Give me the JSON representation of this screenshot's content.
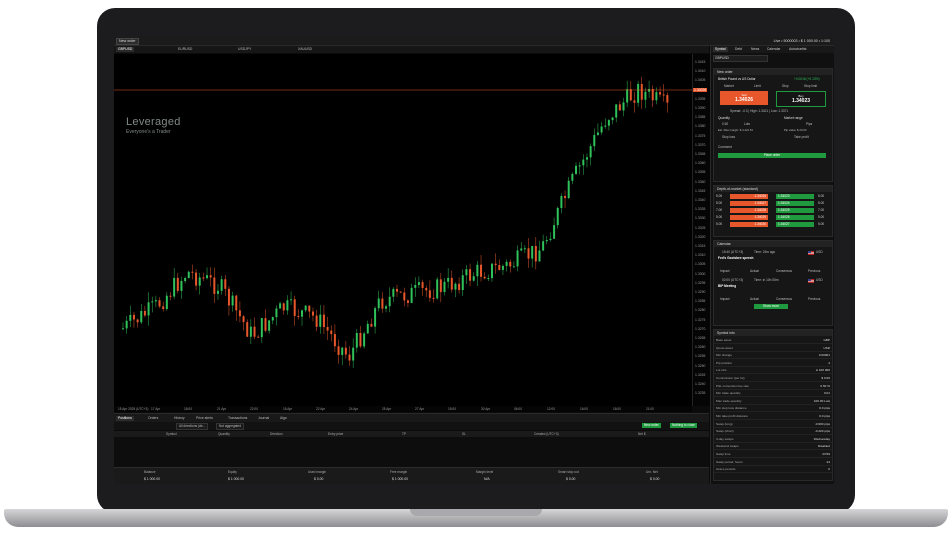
{
  "topbar": {
    "new_order_label": "New order",
    "account_info": "Live • 5000003 • $ 1 000.00 • 1:100"
  },
  "chart_tabs": [
    {
      "label": "GBPUSD"
    },
    {
      "label": "EURUSD"
    },
    {
      "label": "USDJPY"
    },
    {
      "label": "XAUUSD"
    }
  ],
  "brand": {
    "name": "Leveraged",
    "tagline": "Everyone's a Trader"
  },
  "price_axis": [
    "1.3415",
    "1.3410",
    "1.3405",
    "1.3400",
    "1.3395",
    "1.3390",
    "1.3385",
    "1.3380",
    "1.3375",
    "1.3370",
    "1.3365",
    "1.3360",
    "1.3355",
    "1.3350",
    "1.3345",
    "1.3340",
    "1.3335",
    "1.3330",
    "1.3325",
    "1.3320",
    "1.3315",
    "1.3310",
    "1.3305",
    "1.3300",
    "1.3295",
    "1.3290",
    "1.3285",
    "1.3280",
    "1.3275",
    "1.3270",
    "1.3265",
    "1.3260",
    "1.3255",
    "1.3250",
    "1.3245",
    "1.3240",
    "1.3235"
  ],
  "current_price_label": "1.34026",
  "time_axis": [
    "15 Apr 2025 (UTC+3)",
    "17 Apr",
    "18:00",
    "21 Apr",
    "22:00",
    "18 Apr",
    "22 Apr",
    "24 Apr",
    "25 Apr",
    "27 Apr",
    "15:00",
    "30 Apr",
    "06:00",
    "12:00",
    "16:00",
    "18:00",
    "21:00"
  ],
  "bottom_tabs": [
    {
      "label": "Positions",
      "active": true
    },
    {
      "label": "Orders"
    },
    {
      "label": "History"
    },
    {
      "label": "Price alerts"
    },
    {
      "label": "Transactions"
    },
    {
      "label": "Journal"
    },
    {
      "label": "Algo"
    }
  ],
  "filters": {
    "directions": "All directions (de...",
    "aggregation": "Not aggregated",
    "new_order": "New order",
    "close_btn": "Nothing to close"
  },
  "table_columns": [
    "Symbol",
    "Quantity",
    "Direction",
    "Entry price",
    "TP",
    "SL",
    "Created (UTC+3)",
    "Net $"
  ],
  "summary": [
    {
      "label": "Balance",
      "value": "$ 1 000.00"
    },
    {
      "label": "Equity",
      "value": "$ 1 000.00"
    },
    {
      "label": "Used margin",
      "value": "$ 0.00"
    },
    {
      "label": "Free margin",
      "value": "$ 1 000.00"
    },
    {
      "label": "Margin level",
      "value": "N/A"
    },
    {
      "label": "Smart stop out",
      "value": "$ 0.00"
    },
    {
      "label": "Unr. Net",
      "value": "$ 0.00"
    }
  ],
  "right_panel": {
    "tabs": [
      "Symbol",
      "Debt",
      "News",
      "Calendar",
      "Autochartist"
    ],
    "symbol": "GBPUSD",
    "new_order": {
      "title": "New order",
      "instrument": "British Pound vs US Dollar",
      "change": "+0.0018 (+0.13%)",
      "order_types": [
        "Market",
        "Limit",
        "Stop",
        "Stop limit"
      ],
      "sell_label": "Sell",
      "sell_price": "1.34026",
      "buy_label": "Buy",
      "buy_price": "1.34023",
      "spread": "Spread: -0.3 | High: 1.3421 | Low: 1.3371",
      "quantity_label": "Quantity",
      "market_range_label": "Market range",
      "qty_value": "0.50",
      "qty_unit": "Lots",
      "trade_margin": "Est. Max margin: $ 4 421.51",
      "pip_value": "Pip value: $ 20.00",
      "pips_label": "Pips",
      "stop_loss": "Stop loss",
      "take_profit": "Take profit",
      "comment": "Comment",
      "place_order": "Place order"
    },
    "dom": {
      "title": "Depth-of-market (standard)",
      "rows": [
        {
          "bid_size": "5.00",
          "bid": "1.34026",
          "ask": "1.34023",
          "ask_size": "5.00"
        },
        {
          "bid_size": "5.00",
          "bid": "1.34027",
          "ask": "1.34024",
          "ask_size": "5.00"
        },
        {
          "bid_size": "7.00",
          "bid": "1.34028",
          "ask": "1.34025",
          "ask_size": "7.00"
        },
        {
          "bid_size": "5.00",
          "bid": "1.34029",
          "ask": "1.34026",
          "ask_size": "5.00"
        },
        {
          "bid_size": "5.00",
          "bid": "1.34030",
          "ask": "1.34027",
          "ask_size": "5.00"
        }
      ]
    },
    "calendar": {
      "title": "Calendar",
      "events": [
        {
          "time": "15:40 (UTC+3)",
          "when": "Time: 24m ago",
          "name": "Fed's Goolsbee speech",
          "currency": "USD"
        },
        {
          "time": "02:00 (UTC+3)",
          "when": "Time: in 10h 55m",
          "name": "BIP Meeting",
          "currency": "USD"
        }
      ],
      "cols": [
        "Impact",
        "Actual",
        "Consensus",
        "Previous"
      ],
      "show_more": "Show more"
    },
    "symbol_info": {
      "title": "Symbol info",
      "rows": [
        {
          "k": "Base asset",
          "v": "GBP"
        },
        {
          "k": "Quote asset",
          "v": "USD"
        },
        {
          "k": "Min change",
          "v": "0.00001"
        },
        {
          "k": "Pip position",
          "v": "4"
        },
        {
          "k": "Lot size",
          "v": "£ 100 000"
        },
        {
          "k": "Commission (per lot)",
          "v": "$ 0.00"
        },
        {
          "k": "P&L conversion fee rate",
          "v": "0.50 %"
        },
        {
          "k": "Min trade quantity",
          "v": "0.01"
        },
        {
          "k": "Max trade quantity",
          "v": "100.00 Lots"
        },
        {
          "k": "Min stop loss distance",
          "v": "0.0 pips"
        },
        {
          "k": "Min take profit distance",
          "v": "0.0 pips"
        },
        {
          "k": "Swap (long)",
          "v": "-0.990 pips"
        },
        {
          "k": "Swap (short)",
          "v": "-0.420 pips"
        },
        {
          "k": "3-day swaps",
          "v": "Wednesday"
        },
        {
          "k": "Weekend swaps",
          "v": "Disabled"
        },
        {
          "k": "Swap time",
          "v": "23:59"
        },
        {
          "k": "Swap period, hours",
          "v": "24"
        },
        {
          "k": "Grace periods",
          "v": "0"
        }
      ]
    }
  }
}
